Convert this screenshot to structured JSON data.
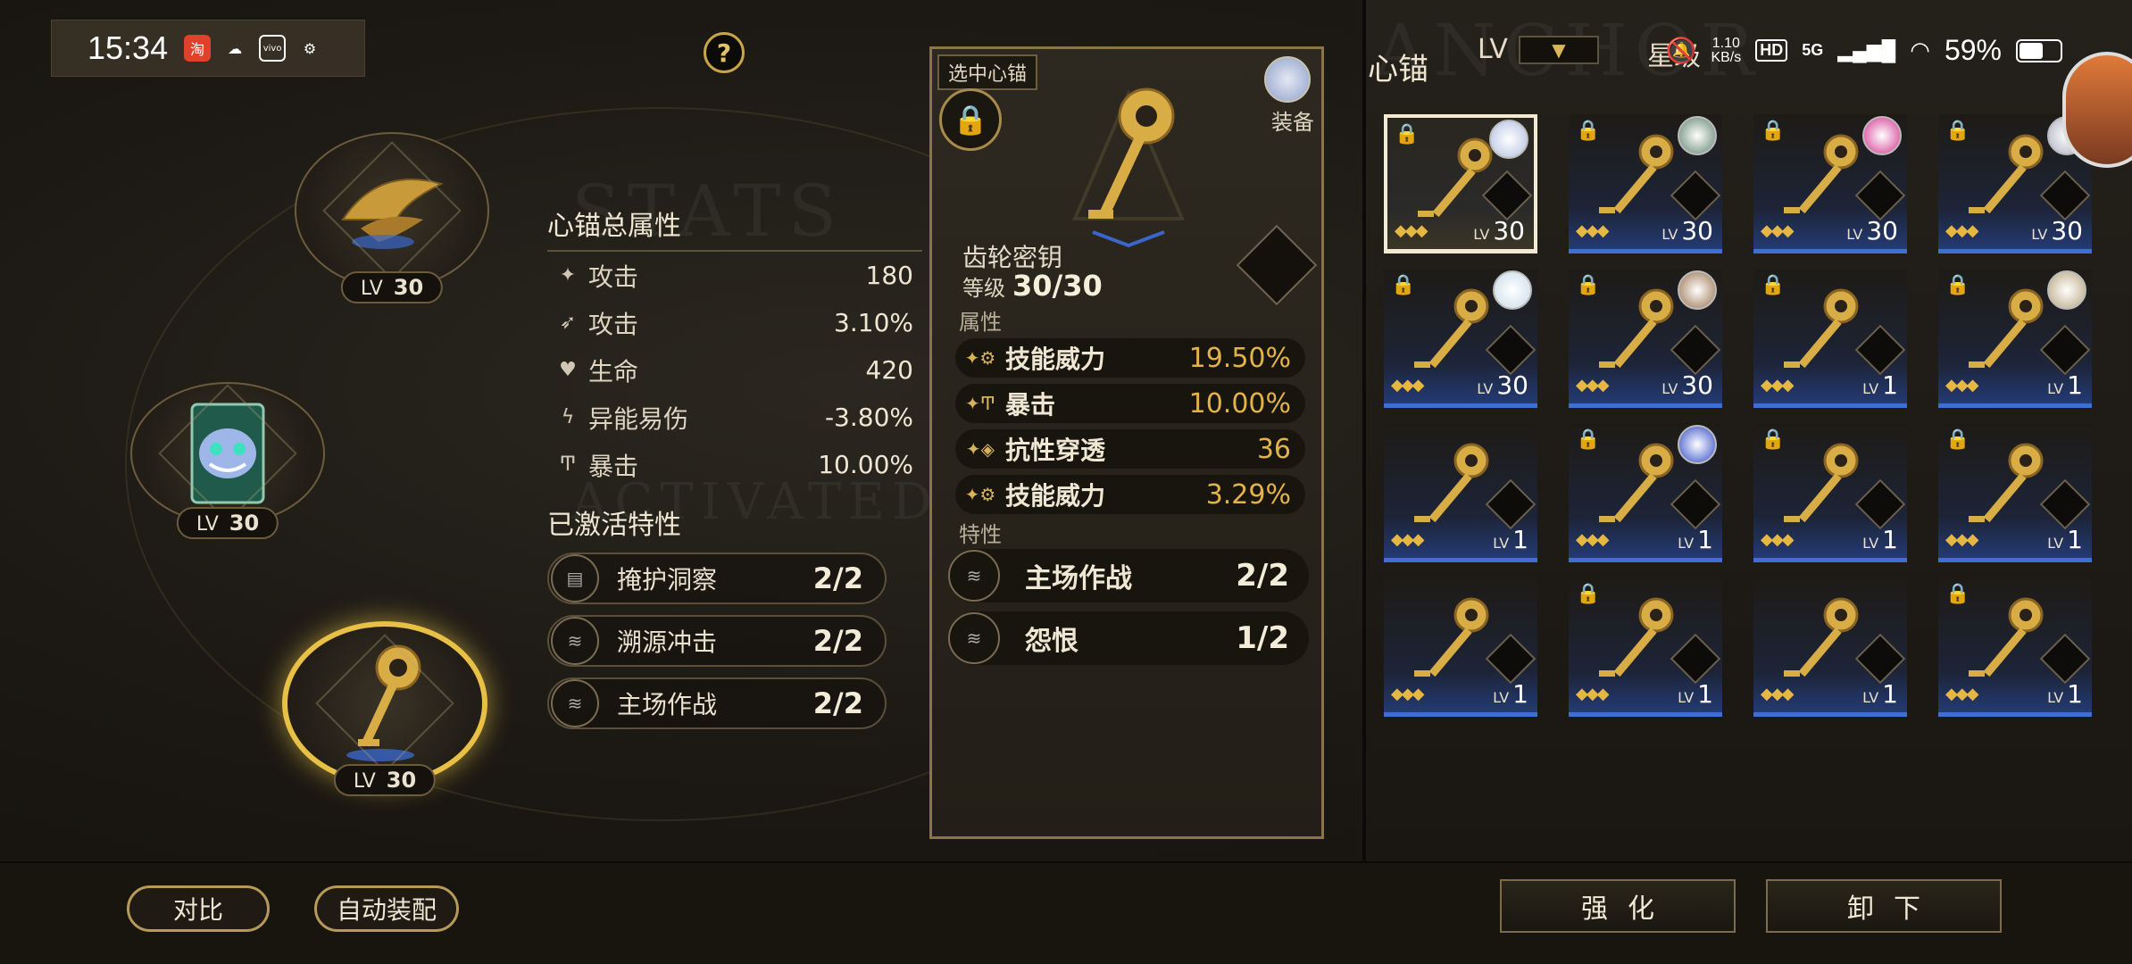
{
  "status_bar": {
    "time": "15:34",
    "net_speed_value": "1.10",
    "net_speed_unit": "KB/s",
    "hd": "HD",
    "signal": "5G",
    "battery": "59%",
    "battery_level": 0.59
  },
  "help": {
    "label": "?"
  },
  "watermarks": {
    "stats": "STATS",
    "activated": "ACTIVATED",
    "anchor": "ANCHOR"
  },
  "nodes": [
    {
      "lv_label": "LV",
      "lv": "30"
    },
    {
      "lv_label": "LV",
      "lv": "30"
    },
    {
      "lv_label": "LV",
      "lv": "30"
    }
  ],
  "stats": {
    "title": "心锚总属性",
    "rows": [
      {
        "name": "攻击",
        "value": "180"
      },
      {
        "name": "攻击",
        "value": "3.10%"
      },
      {
        "name": "生命",
        "value": "420"
      },
      {
        "name": "异能易伤",
        "value": "-3.80%"
      },
      {
        "name": "暴击",
        "value": "10.00%"
      }
    ],
    "traits_title": "已激活特性",
    "traits": [
      {
        "name": "掩护洞察",
        "value": "2/2"
      },
      {
        "name": "溯源冲击",
        "value": "2/2"
      },
      {
        "name": "主场作战",
        "value": "2/2"
      }
    ]
  },
  "detail": {
    "selected_tag": "选中心锚",
    "equip_label": "装备",
    "name": "齿轮密钥",
    "level_label": "等级",
    "level": "30/30",
    "attr_title": "属性",
    "attrs": [
      {
        "name": "技能威力",
        "value": "19.50%"
      },
      {
        "name": "暴击",
        "value": "10.00%"
      },
      {
        "name": "抗性穿透",
        "value": "36"
      },
      {
        "name": "技能威力",
        "value": "3.29%"
      }
    ],
    "trait_title": "特性",
    "traits": [
      {
        "name": "主场作战",
        "value": "2/2"
      },
      {
        "name": "怨恨",
        "value": "1/2"
      }
    ]
  },
  "grid": {
    "title": "心锚",
    "filter_lv": "LV",
    "filter_star": "星级",
    "cards": [
      {
        "locked": true,
        "avatar": true,
        "avatar_color": "#c9d3ea",
        "lv": "30",
        "selected": true
      },
      {
        "locked": true,
        "avatar": true,
        "avatar_color": "#8fa89a",
        "lv": "30"
      },
      {
        "locked": true,
        "avatar": true,
        "avatar_color": "#e070b0",
        "lv": "30"
      },
      {
        "locked": true,
        "avatar": true,
        "avatar_color": "#c6c9d6",
        "lv": "30"
      },
      {
        "locked": true,
        "avatar": true,
        "avatar_color": "#d9e6f0",
        "lv": "30"
      },
      {
        "locked": true,
        "avatar": true,
        "avatar_color": "#b79a80",
        "lv": "30"
      },
      {
        "locked": true,
        "avatar": false,
        "lv": "1"
      },
      {
        "locked": true,
        "avatar": true,
        "avatar_color": "#cdbfa4",
        "lv": "1"
      },
      {
        "locked": false,
        "avatar": false,
        "lv": "1"
      },
      {
        "locked": true,
        "avatar": true,
        "avatar_color": "#6d7fd6",
        "lv": "1"
      },
      {
        "locked": true,
        "avatar": false,
        "lv": "1"
      },
      {
        "locked": true,
        "avatar": false,
        "lv": "1"
      },
      {
        "locked": false,
        "avatar": false,
        "lv": "1"
      },
      {
        "locked": true,
        "avatar": false,
        "lv": "1"
      },
      {
        "locked": false,
        "avatar": false,
        "lv": "1"
      },
      {
        "locked": true,
        "avatar": false,
        "lv": "1"
      }
    ]
  },
  "bottom": {
    "compare": "对比",
    "auto_equip": "自动装配",
    "enhance": "强化",
    "unequip": "卸下"
  }
}
